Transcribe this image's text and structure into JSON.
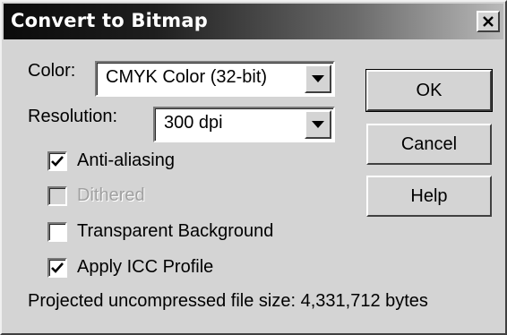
{
  "window": {
    "title": "Convert to Bitmap",
    "close_icon": "close-icon"
  },
  "color": {
    "label": "Color:",
    "value": "CMYK Color (32-bit)"
  },
  "resolution": {
    "label": "Resolution:",
    "value": "300 dpi"
  },
  "options": {
    "anti_aliasing": {
      "label": "Anti-aliasing",
      "checked": true,
      "enabled": true
    },
    "dithered": {
      "label": "Dithered",
      "checked": false,
      "enabled": false
    },
    "transparent_background": {
      "label": "Transparent Background",
      "checked": false,
      "enabled": true
    },
    "apply_icc_profile": {
      "label": "Apply ICC Profile",
      "checked": true,
      "enabled": true
    }
  },
  "buttons": {
    "ok": "OK",
    "cancel": "Cancel",
    "help": "Help"
  },
  "status": {
    "file_size_text": "Projected uncompressed file size: 4,331,712 bytes"
  },
  "colors": {
    "dialog_face": "#d4d4d4",
    "titlebar_start": "#0b0b0b",
    "titlebar_end": "#b9b9b9",
    "disabled_text": "#a0a0a0"
  }
}
